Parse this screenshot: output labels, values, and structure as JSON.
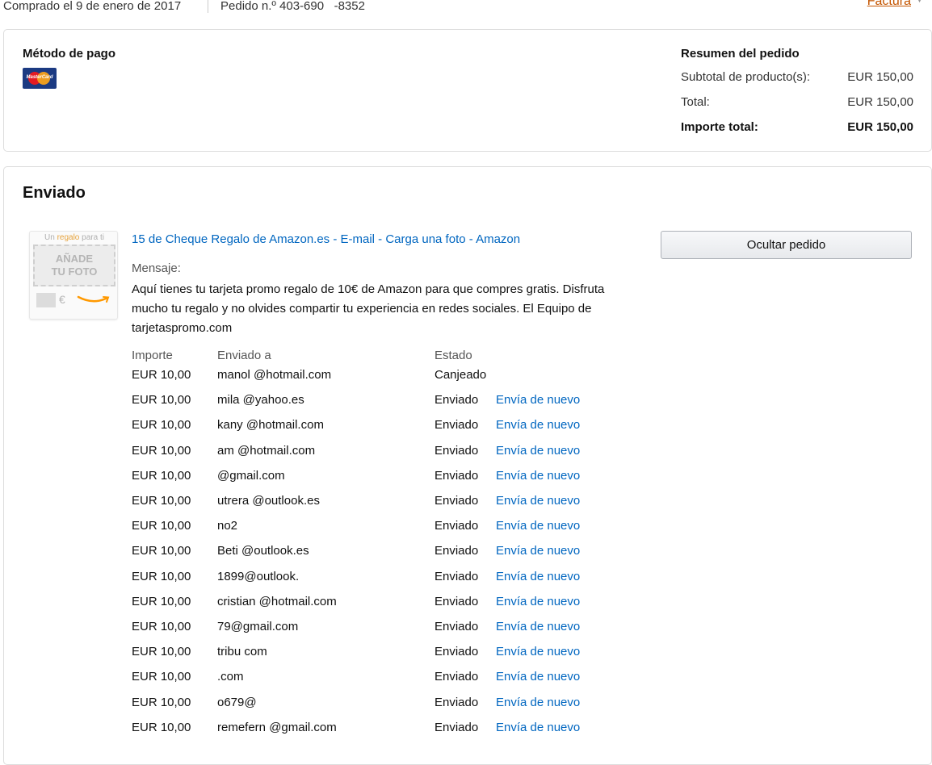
{
  "header": {
    "purchased_label": "Comprado el 9 de enero de 2017",
    "order_label": "Pedido n.º 403-690 ‌ ‌ ‌-8352",
    "invoice_label": "Factura"
  },
  "payment": {
    "title": "Método de pago",
    "card_icon": "mastercard-icon",
    "card_text": "MasterCard"
  },
  "order_summary": {
    "title": "Resumen del pedido",
    "subtotal_label": "Subtotal de producto(s):",
    "subtotal_value": "EUR 150,00",
    "total_label": "Total:",
    "total_value": "EUR 150,00",
    "grand_total_label": "Importe total:",
    "grand_total_value": "EUR 150,00"
  },
  "shipment": {
    "title": "Enviado",
    "thumbnail": {
      "top_text_prefix": "Un ",
      "top_text_highlight": "regalo",
      "top_text_suffix": " para ti",
      "photo_line1": "AÑADE",
      "photo_line2": "TU FOTO",
      "euro": "€"
    },
    "product_link": "15 de Cheque Regalo de Amazon.es - E-mail - Carga una foto - Amazon",
    "message_label": "Mensaje:",
    "message_text": "Aquí tienes tu tarjeta promo regalo de 10€ de Amazon para que compres gratis. Disfruta mucho tu regalo y no olvides compartir tu experiencia en redes sociales. El Equipo de tarjetaspromo.com",
    "hide_button": "Ocultar pedido",
    "columns": {
      "amount": "Importe",
      "sent_to": "Enviado a",
      "status": "Estado"
    },
    "rows": [
      {
        "amount": "EUR 10,00",
        "sent_to": "manol        @hotmail.com",
        "status": "Canjeado",
        "resend": ""
      },
      {
        "amount": "EUR 10,00",
        "sent_to": "mila     @yahoo.es",
        "status": "Enviado",
        "resend": "Envía de nuevo"
      },
      {
        "amount": "EUR 10,00",
        "sent_to": "kany       @hotmail.com",
        "status": "Enviado",
        "resend": "Envía de nuevo"
      },
      {
        "amount": "EUR 10,00",
        "sent_to": "am      @hotmail.com",
        "status": "Enviado",
        "resend": "Envía de nuevo"
      },
      {
        "amount": "EUR 10,00",
        "sent_to": "         @gmail.com",
        "status": "Enviado",
        "resend": "Envía de nuevo"
      },
      {
        "amount": "EUR 10,00",
        "sent_to": "utrera      @outlook.es",
        "status": "Enviado",
        "resend": "Envía de nuevo"
      },
      {
        "amount": "EUR 10,00",
        "sent_to": "        no2",
        "status": "Enviado",
        "resend": "Envía de nuevo"
      },
      {
        "amount": "EUR 10,00",
        "sent_to": "Beti        @outlook.es",
        "status": "Enviado",
        "resend": "Envía de nuevo"
      },
      {
        "amount": "EUR 10,00",
        "sent_to": "         1899@outlook.",
        "status": "Enviado",
        "resend": "Envía de nuevo"
      },
      {
        "amount": "EUR 10,00",
        "sent_to": "cristian        @hotmail.com",
        "status": "Enviado",
        "resend": "Envía de nuevo"
      },
      {
        "amount": "EUR 10,00",
        "sent_to": "          79@gmail.com",
        "status": "Enviado",
        "resend": "Envía de nuevo"
      },
      {
        "amount": "EUR 10,00",
        "sent_to": "tribu               com",
        "status": "Enviado",
        "resend": "Envía de nuevo"
      },
      {
        "amount": "EUR 10,00",
        "sent_to": "               .com",
        "status": "Enviado",
        "resend": "Envía de nuevo"
      },
      {
        "amount": "EUR 10,00",
        "sent_to": "      o679@",
        "status": "Enviado",
        "resend": "Envía de nuevo"
      },
      {
        "amount": "EUR 10,00",
        "sent_to": "remefern         @gmail.com",
        "status": "Enviado",
        "resend": "Envía de nuevo"
      }
    ]
  },
  "colors": {
    "link": "#0066c0",
    "invoice_link": "#c45500",
    "card_blue": "#1b3a82",
    "card_red": "#e31b23",
    "card_orange": "#f7a21b",
    "smile_orange": "#ff9900"
  }
}
